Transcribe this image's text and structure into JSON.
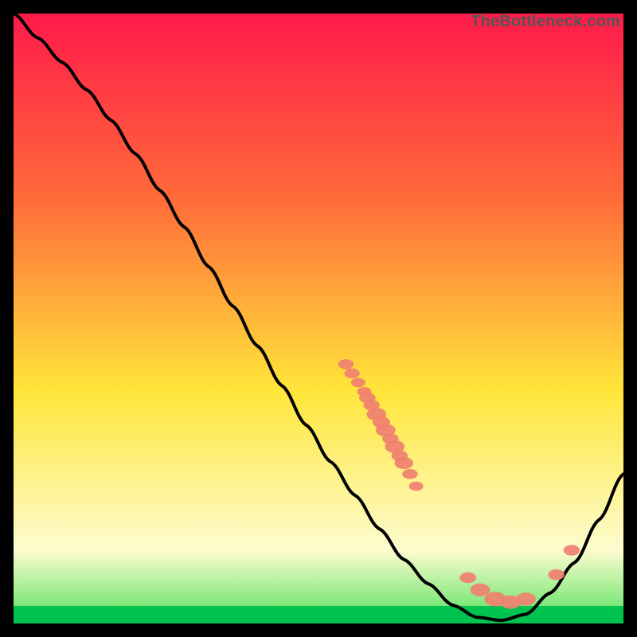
{
  "watermark": "TheBottleneck.com",
  "colors": {
    "gradient_top": "#ff1a4a",
    "gradient_mid1": "#ff6a3a",
    "gradient_mid2": "#ffe63a",
    "gradient_mid3": "#fdfccf",
    "gradient_bottom": "#00e05a",
    "bottom_band": "#00c24f",
    "curve": "#000000",
    "points": "#f08070",
    "frame": "#000000"
  },
  "chart_data": {
    "type": "line",
    "title": "",
    "xlabel": "",
    "ylabel": "",
    "xlim": [
      0,
      100
    ],
    "ylim": [
      0,
      100
    ],
    "grid": false,
    "series": [
      {
        "name": "bottleneck-curve",
        "x": [
          0,
          4,
          8,
          12,
          16,
          20,
          24,
          28,
          32,
          36,
          40,
          44,
          48,
          52,
          56,
          60,
          64,
          68,
          72,
          76,
          80,
          84,
          88,
          92,
          96,
          100
        ],
        "y": [
          100,
          96,
          92,
          87.5,
          82.5,
          77,
          71,
          65,
          58.5,
          52,
          45.5,
          39,
          32.5,
          26.5,
          21,
          15.5,
          10.5,
          6.5,
          3,
          1,
          0.5,
          1.5,
          5,
          10,
          17,
          24.5
        ]
      }
    ],
    "scatter": {
      "name": "highlight-points",
      "points": [
        {
          "x": 54.5,
          "y": 42.5,
          "r": 1.4
        },
        {
          "x": 55.5,
          "y": 41,
          "r": 1.4
        },
        {
          "x": 56.5,
          "y": 39.5,
          "r": 1.3
        },
        {
          "x": 57.5,
          "y": 38,
          "r": 1.3
        },
        {
          "x": 58,
          "y": 37,
          "r": 1.5
        },
        {
          "x": 58.7,
          "y": 35.8,
          "r": 1.5
        },
        {
          "x": 59.5,
          "y": 34.3,
          "r": 1.8
        },
        {
          "x": 60.3,
          "y": 33,
          "r": 1.6
        },
        {
          "x": 61,
          "y": 31.7,
          "r": 1.8
        },
        {
          "x": 61.8,
          "y": 30.3,
          "r": 1.5
        },
        {
          "x": 62.5,
          "y": 29,
          "r": 1.8
        },
        {
          "x": 63.3,
          "y": 27.5,
          "r": 1.5
        },
        {
          "x": 64,
          "y": 26.3,
          "r": 1.7
        },
        {
          "x": 65,
          "y": 24.5,
          "r": 1.4
        },
        {
          "x": 66,
          "y": 22.5,
          "r": 1.3
        },
        {
          "x": 74.5,
          "y": 7.5,
          "r": 1.5
        },
        {
          "x": 76.5,
          "y": 5.5,
          "r": 1.8
        },
        {
          "x": 79,
          "y": 4,
          "r": 2.0
        },
        {
          "x": 81.5,
          "y": 3.5,
          "r": 1.9
        },
        {
          "x": 84,
          "y": 4,
          "r": 1.8
        },
        {
          "x": 89,
          "y": 8,
          "r": 1.5
        },
        {
          "x": 91.5,
          "y": 12,
          "r": 1.5
        }
      ]
    }
  }
}
